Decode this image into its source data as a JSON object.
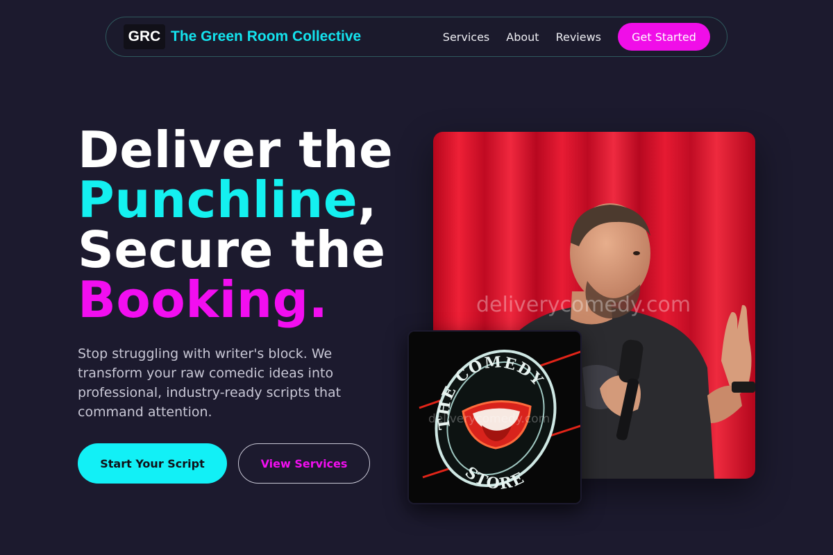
{
  "nav": {
    "logo_badge": "GRC",
    "brand_name": "The Green Room Collective",
    "links": [
      "Services",
      "About",
      "Reviews"
    ],
    "cta_label": "Get Started"
  },
  "hero": {
    "title": {
      "line1": "Deliver the",
      "line2_accent": "Punchline",
      "line2_suffix": ",",
      "line3": "Secure the",
      "line4_accent": "Booking."
    },
    "subtitle": "Stop struggling with writer's block. We transform your raw comedic ideas into professional, industry-ready scripts that command attention.",
    "primary_button": "Start Your Script",
    "secondary_button": "View Services"
  },
  "images": {
    "main_watermark": "deliverycomedy.com",
    "inset_watermark": "deliverycomedy.com",
    "inset_sign_text": "THE COMEDY STORE"
  },
  "colors": {
    "background": "#1c1a2e",
    "accent_cyan": "#14f0f0",
    "accent_magenta": "#f20ef0"
  }
}
